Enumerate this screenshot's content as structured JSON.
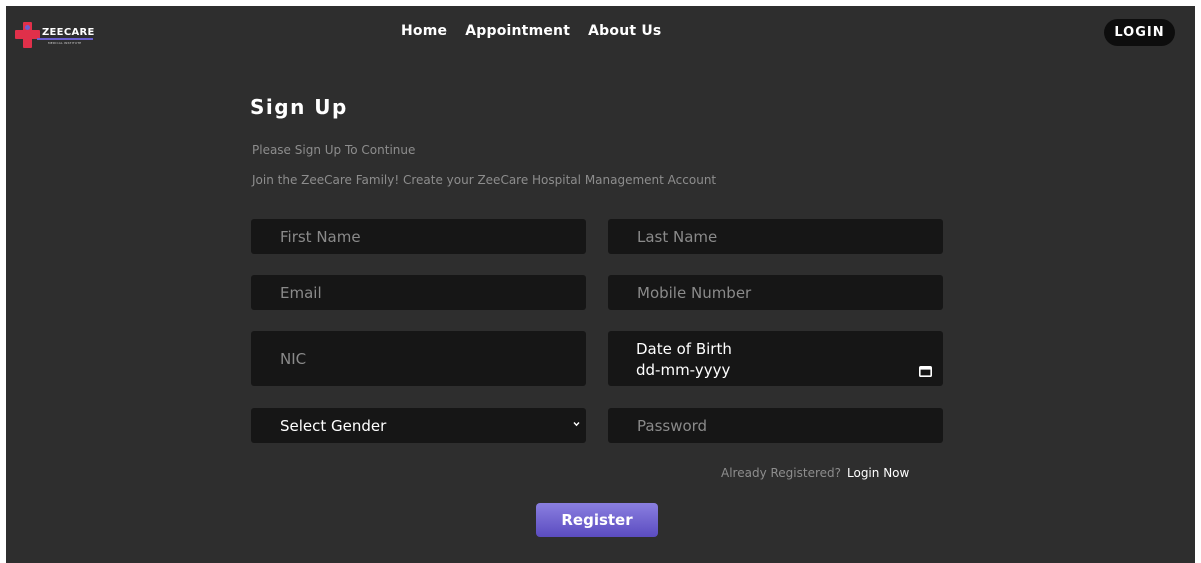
{
  "navbar": {
    "logo_text": "ZEECARE",
    "logo_subtext": "MEDICAL INSTITUTE",
    "links": [
      "Home",
      "Appointment",
      "About Us"
    ],
    "login_label": "LOGIN"
  },
  "form": {
    "title": "Sign Up",
    "subtitle": "Please Sign Up To Continue",
    "description": "Join the ZeeCare Family! Create your ZeeCare Hospital Management Account",
    "first_name_placeholder": "First Name",
    "last_name_placeholder": "Last Name",
    "email_placeholder": "Email",
    "mobile_placeholder": "Mobile Number",
    "nic_placeholder": "NIC",
    "dob_label": "Date of Birth",
    "dob_value": "dd-mm-yyyy",
    "gender_value": "Select Gender",
    "password_placeholder": "Password",
    "already_text": "Already Registered?",
    "login_now": "Login Now",
    "register_label": "Register"
  },
  "colors": {
    "background": "#2e2e2e",
    "field": "#161616",
    "accent": "#6a5fd0",
    "logo_red": "#e0304a"
  },
  "icons": [
    "medical-cross-icon",
    "calendar-icon",
    "chevron-down-icon"
  ]
}
